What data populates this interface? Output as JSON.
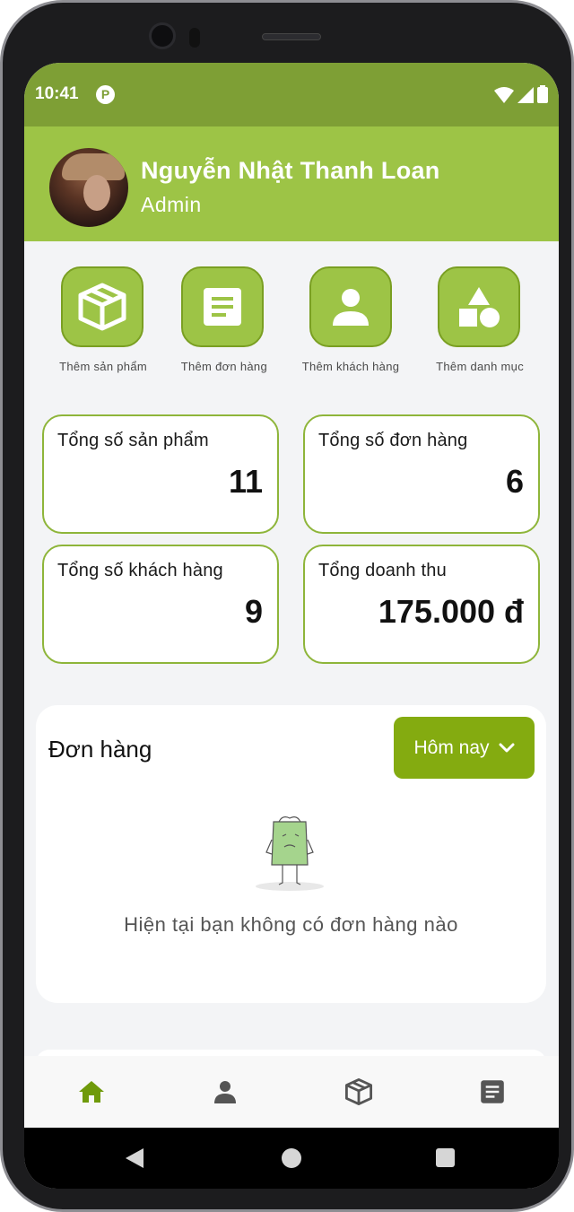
{
  "status_bar": {
    "time": "10:41",
    "notification_glyph": "P",
    "icons": [
      "wifi-icon",
      "signal-icon",
      "battery-icon"
    ]
  },
  "header": {
    "user_name": "Nguyễn Nhật Thanh Loan",
    "role": "Admin"
  },
  "quick_actions": [
    {
      "label": "Thêm sản phẩm",
      "icon": "box-icon"
    },
    {
      "label": "Thêm đơn hàng",
      "icon": "document-icon"
    },
    {
      "label": "Thêm khách hàng",
      "icon": "person-icon"
    },
    {
      "label": "Thêm danh mục",
      "icon": "shapes-icon"
    }
  ],
  "stats": [
    {
      "label": "Tổng số sản phẩm",
      "value": "11"
    },
    {
      "label": "Tổng số đơn hàng",
      "value": "6"
    },
    {
      "label": "Tổng số khách hàng",
      "value": "9"
    },
    {
      "label": "Tổng doanh thu",
      "value": "175.000 đ"
    }
  ],
  "orders": {
    "title": "Đơn hàng",
    "period": "Hôm nay",
    "empty_message": "Hiện tại bạn không có đơn hàng nào"
  },
  "bottom_nav": [
    {
      "icon": "home-icon",
      "active": true
    },
    {
      "icon": "person-icon",
      "active": false
    },
    {
      "icon": "box-icon",
      "active": false
    },
    {
      "icon": "document-icon",
      "active": false
    }
  ],
  "colors": {
    "status_bar": "#7e9f35",
    "header": "#9dc446",
    "accent": "#84ab10",
    "nav_active": "#6f9a0a",
    "nav_inactive": "#555555"
  }
}
